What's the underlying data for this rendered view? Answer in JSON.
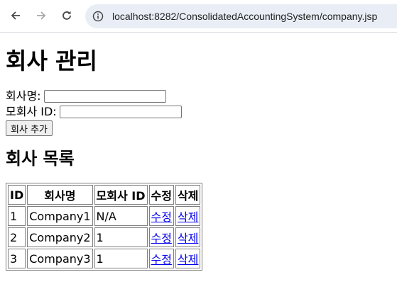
{
  "browser": {
    "url": "localhost:8282/ConsolidatedAccountingSystem/company.jsp"
  },
  "page": {
    "title": "회사 관리",
    "form": {
      "company_name_label": "회사명:",
      "company_name_value": "",
      "parent_id_label": "모회사 ID:",
      "parent_id_value": "",
      "add_button": "회사 추가"
    },
    "list_title": "회사 목록",
    "table": {
      "headers": [
        "ID",
        "회사명",
        "모회사 ID",
        "수정",
        "삭제"
      ],
      "rows": [
        {
          "id": "1",
          "name": "Company1",
          "parent": "N/A",
          "edit": "수정",
          "delete": "삭제"
        },
        {
          "id": "2",
          "name": "Company2",
          "parent": "1",
          "edit": "수정",
          "delete": "삭제"
        },
        {
          "id": "3",
          "name": "Company3",
          "parent": "1",
          "edit": "수정",
          "delete": "삭제"
        }
      ]
    }
  }
}
